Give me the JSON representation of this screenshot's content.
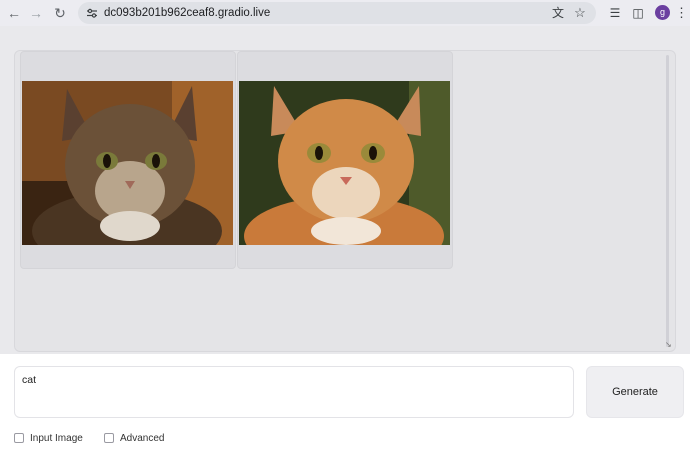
{
  "browser": {
    "url": "dc093b201b962ceaf8.gradio.live",
    "avatar_letter": "g"
  },
  "prompt": {
    "value": "cat"
  },
  "generate_button": {
    "label": "Generate"
  },
  "options": {
    "input_image_label": "Input Image",
    "advanced_label": "Advanced",
    "input_image_checked": false,
    "advanced_checked": false
  },
  "gallery": {
    "images": [
      {
        "description_icon": "tabby-cat-image"
      },
      {
        "description_icon": "orange-cat-image"
      }
    ]
  },
  "colors": {
    "avatar": "#6b3fa0",
    "overlay": "#e9e9ec"
  }
}
